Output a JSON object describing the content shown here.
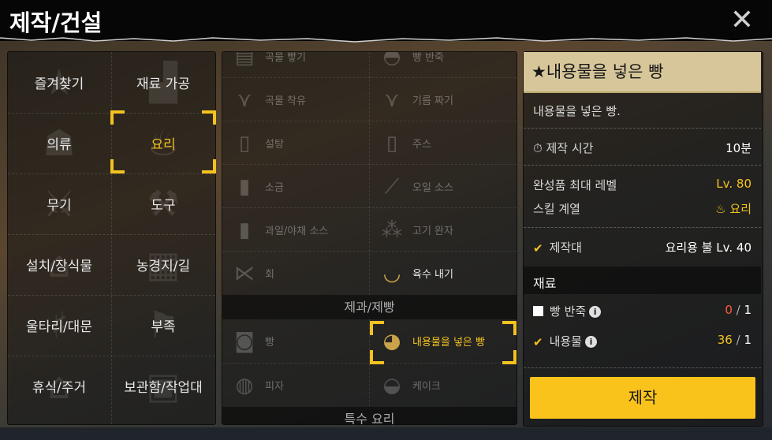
{
  "header": {
    "title": "제작/건설",
    "close_icon": "✕"
  },
  "categories": [
    {
      "label": "즐겨찾기",
      "icon": "star-icon",
      "glyph": "★"
    },
    {
      "label": "재료 가공",
      "icon": "anvil-icon",
      "glyph": "▟"
    },
    {
      "label": "의류",
      "icon": "shirt-icon",
      "glyph": "☗"
    },
    {
      "label": "요리",
      "icon": "chef-hat-icon",
      "glyph": "♨",
      "selected": true
    },
    {
      "label": "무기",
      "icon": "sword-icon",
      "glyph": "⚔"
    },
    {
      "label": "도구",
      "icon": "shovel-icon",
      "glyph": "⚒"
    },
    {
      "label": "설치/장식물",
      "icon": "furniture-icon",
      "glyph": "⌂"
    },
    {
      "label": "농경지/길",
      "icon": "field-icon",
      "glyph": "▦"
    },
    {
      "label": "울타리/대문",
      "icon": "fence-icon",
      "glyph": "♯"
    },
    {
      "label": "부족",
      "icon": "flag-icon",
      "glyph": "⚑"
    },
    {
      "label": "휴식/주거",
      "icon": "house-icon",
      "glyph": "⌂"
    },
    {
      "label": "보관함/작업대",
      "icon": "chest-icon",
      "glyph": "▣"
    }
  ],
  "recipes": {
    "top": [
      {
        "label": "곡물 빻기",
        "icon": "grinder-icon",
        "glyph": "▤"
      },
      {
        "label": "빵 반죽",
        "icon": "dough-icon",
        "glyph": "◓"
      },
      {
        "label": "곡물 착유",
        "icon": "press-icon",
        "glyph": "⋎"
      },
      {
        "label": "기름 짜기",
        "icon": "oil-press-icon",
        "glyph": "⋎"
      },
      {
        "label": "설탕",
        "icon": "sugar-jar-icon",
        "glyph": "▯"
      },
      {
        "label": "주스",
        "icon": "juice-glass-icon",
        "glyph": "▯"
      },
      {
        "label": "소금",
        "icon": "salt-icon",
        "glyph": "▮"
      },
      {
        "label": "오일 소스",
        "icon": "oil-bottle-icon",
        "glyph": "⟋"
      },
      {
        "label": "과일/야채 소스",
        "icon": "sauce-jar-icon",
        "glyph": "▮"
      },
      {
        "label": "고기 완자",
        "icon": "meatball-icon",
        "glyph": "⁂"
      },
      {
        "label": "회",
        "icon": "fish-icon",
        "glyph": "⋉"
      },
      {
        "label": "육수 내기",
        "icon": "pot-icon",
        "glyph": "◡",
        "available": true
      }
    ],
    "section_baking": "제과/제빵",
    "baking": [
      {
        "label": "빵",
        "icon": "bread-loaf-icon",
        "glyph": "◙"
      },
      {
        "label": "내용물을 넣은 빵",
        "icon": "stuffed-bread-icon",
        "glyph": "◕",
        "available": true,
        "selected": true
      },
      {
        "label": "피자",
        "icon": "pizza-icon",
        "glyph": "◍"
      },
      {
        "label": "케이크",
        "icon": "cake-icon",
        "glyph": "◒"
      }
    ],
    "section_special": "특수 요리"
  },
  "detail": {
    "title": "★내용물을 넣은 빵",
    "description": "내용물을 넣은 빵.",
    "craft_time_label": "제작 시간",
    "craft_time_value": "10분",
    "max_level_label": "완성품 최대 레벨",
    "max_level_value": "Lv. 80",
    "skill_label": "스킬 계열",
    "skill_value": "요리",
    "station_label": "제작대",
    "station_value": "요리용 불 Lv. 40",
    "materials_label": "재료",
    "materials": [
      {
        "name": "빵 반죽",
        "have": "0",
        "sep": " / ",
        "need": "1",
        "checked": false
      },
      {
        "name": "내용물",
        "have": "36",
        "sep": " / ",
        "need": "1",
        "checked": true
      }
    ],
    "craft_button": "제작"
  },
  "colors": {
    "accent": "#f4c21f",
    "title_bg": "#d6c69a",
    "button": "#f9c31c",
    "insufficient": "#ff5b3d"
  }
}
